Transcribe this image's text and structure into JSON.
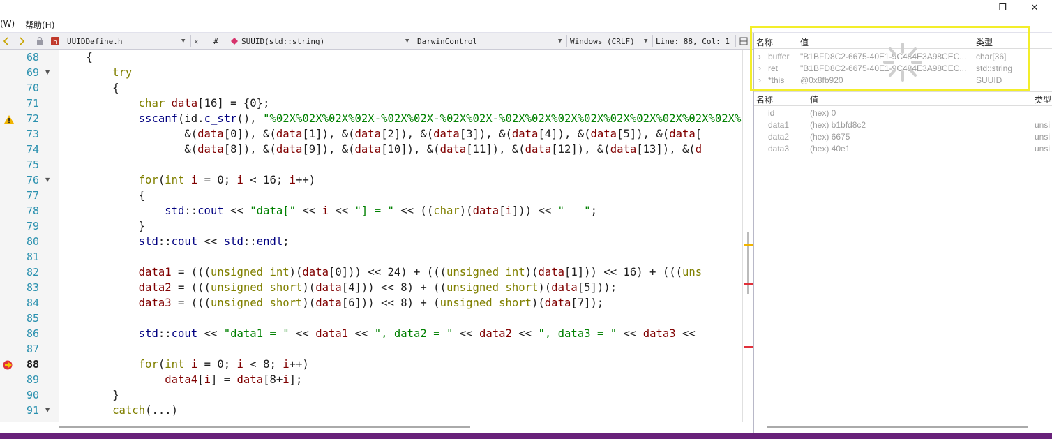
{
  "menu": {
    "window_label": "(W)",
    "help_label": "帮助(H)"
  },
  "window_controls": {
    "minimize": "—",
    "restore": "❐",
    "close": "✕"
  },
  "toolbar": {
    "file_name": "UUIDDefine.h",
    "close_glyph": "✕",
    "hash": "#",
    "function_scope": "SUUID(std::string)",
    "project_scope": "DarwinControl",
    "line_ending": "Windows (CRLF)",
    "position": "Line: 88, Col: 1",
    "dropdown_glyph": "▼"
  },
  "editor": {
    "lines": [
      {
        "num": "68",
        "fold": ""
      },
      {
        "num": "69",
        "fold": "▼"
      },
      {
        "num": "70",
        "fold": ""
      },
      {
        "num": "71",
        "fold": ""
      },
      {
        "num": "72",
        "fold": ""
      },
      {
        "num": "73",
        "fold": ""
      },
      {
        "num": "74",
        "fold": ""
      },
      {
        "num": "75",
        "fold": ""
      },
      {
        "num": "76",
        "fold": "▼"
      },
      {
        "num": "77",
        "fold": ""
      },
      {
        "num": "78",
        "fold": ""
      },
      {
        "num": "79",
        "fold": ""
      },
      {
        "num": "80",
        "fold": ""
      },
      {
        "num": "81",
        "fold": ""
      },
      {
        "num": "82",
        "fold": ""
      },
      {
        "num": "83",
        "fold": ""
      },
      {
        "num": "84",
        "fold": ""
      },
      {
        "num": "85",
        "fold": ""
      },
      {
        "num": "86",
        "fold": ""
      },
      {
        "num": "87",
        "fold": ""
      },
      {
        "num": "88",
        "fold": ""
      },
      {
        "num": "89",
        "fold": ""
      },
      {
        "num": "90",
        "fold": ""
      },
      {
        "num": "91",
        "fold": "▼"
      }
    ],
    "current_line": "88",
    "warning_line": "72"
  },
  "locals_top": {
    "headers": {
      "name": "名称",
      "value": "值",
      "type": "类型"
    },
    "rows": [
      {
        "expander": "›",
        "name": "buffer",
        "value": "\"B1BFD8C2-6675-40E1-9C484E3A98CEC...",
        "type": "char[36]"
      },
      {
        "expander": "›",
        "name": "ret",
        "value": "\"B1BFD8C2-6675-40E1-9C484E3A98CEC...",
        "type": "std::string"
      },
      {
        "expander": "›",
        "name": "*this",
        "value": "@0x8fb920",
        "type": "SUUID"
      }
    ]
  },
  "locals_bottom": {
    "headers": {
      "name": "名称",
      "value": "值",
      "type": "类型"
    },
    "rows": [
      {
        "name": "id",
        "value": "(hex) 0",
        "type": ""
      },
      {
        "name": "data1",
        "value": "(hex) b1bfd8c2",
        "type": "unsi"
      },
      {
        "name": "data2",
        "value": "(hex) 6675",
        "type": "unsi"
      },
      {
        "name": "data3",
        "value": "(hex) 40e1",
        "type": "unsi"
      }
    ]
  },
  "colors": {
    "accent": "#68217a",
    "highlight": "#f3ee2a",
    "line_number": "#2b91af",
    "keyword": "#808000",
    "string": "#008000"
  },
  "icons": [
    "nav-back-icon",
    "nav-forward-icon",
    "lock-icon",
    "header-file-icon",
    "function-icon",
    "warning-icon",
    "breakpoint-arrow-icon",
    "loading-spinner-icon"
  ]
}
